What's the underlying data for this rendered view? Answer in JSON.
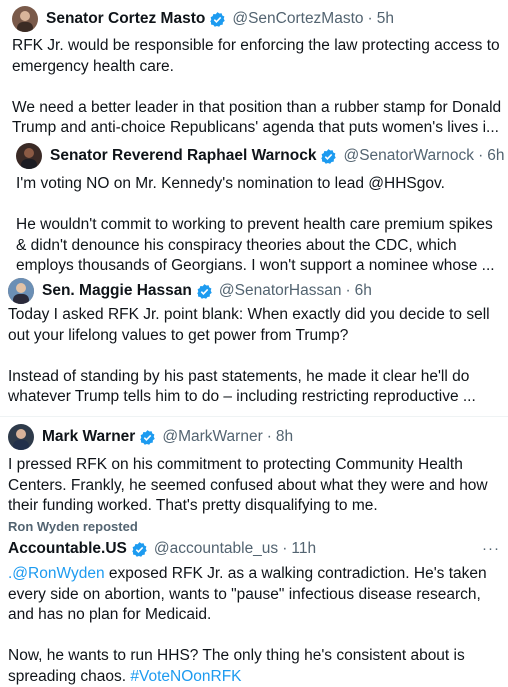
{
  "tweets": [
    {
      "name": "Senator Cortez Masto",
      "handle": "@SenCortezMasto",
      "sep": "·",
      "time": "5h",
      "avatar_color": "#7a5a4a",
      "text": "RFK Jr. would be responsible for enforcing the law protecting access to emergency health care.\n\nWe need a better leader in that position than a rubber stamp for Donald Trump and anti-choice Republicans' agenda that puts women's lives i..."
    },
    {
      "name": "Senator Reverend Raphael Warnock",
      "handle": "@SenatorWarnock",
      "sep": "·",
      "time": "6h",
      "avatar_color": "#3a2a26",
      "text": "I'm voting NO on Mr. Kennedy's nomination to lead @HHSgov.\n\nHe wouldn't commit to working to prevent health care premium spikes & didn't denounce his conspiracy theories about the CDC, which employs thousands of Georgians. I won't support a nominee whose ..."
    },
    {
      "name": "Sen. Maggie Hassan",
      "handle": "@SenatorHassan",
      "sep": "·",
      "time": "6h",
      "avatar_color": "#8a6f5a",
      "text": "Today I asked RFK Jr. point blank: When exactly did you decide to sell out your lifelong values to get power from Trump?\n\nInstead of standing by his past statements, he made it clear he'll do whatever Trump tells him to do – including restricting reproductive ..."
    },
    {
      "name": "Mark Warner",
      "handle": "@MarkWarner",
      "sep": "·",
      "time": "8h",
      "avatar_color": "#2e3a4a",
      "text": "I pressed RFK on his commitment to protecting Community Health Centers. Frankly, he seemed confused about what they were and how their funding worked. That's pretty disqualifying to me."
    }
  ],
  "repost": {
    "label": "Ron Wyden reposted",
    "name": "Accountable.US",
    "handle": "@accountable_us",
    "sep": "·",
    "time": "11h",
    "more": "···",
    "mention": ".@RonWyden",
    "text_part1": " exposed RFK Jr. as a walking contradiction. He's taken every side on abortion, wants to \"pause\" infectious disease research, and has no plan for Medicaid.\n\nNow, he wants to run HHS? The only thing he's consistent about is spreading chaos. ",
    "hashtag": "#VoteNOonRFK"
  },
  "colors": {
    "verified": "#1d9bf0",
    "link": "#1d9bf0",
    "text": "#0f1419",
    "muted": "#536471"
  }
}
